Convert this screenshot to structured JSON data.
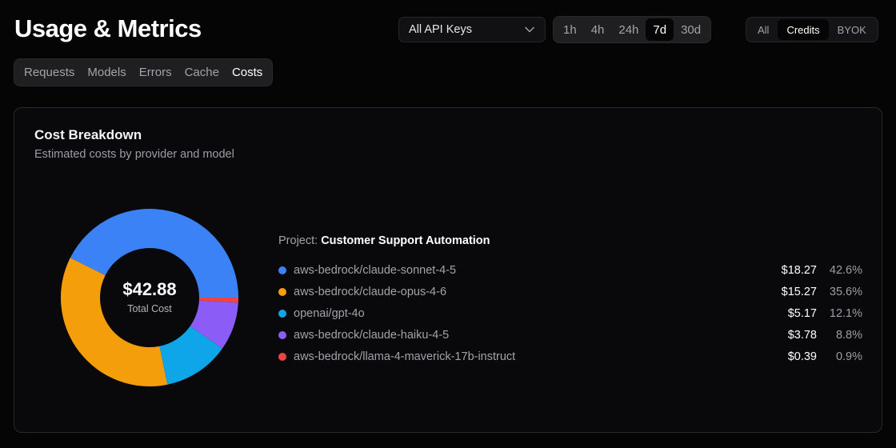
{
  "header": {
    "title": "Usage & Metrics"
  },
  "filters": {
    "api_key_select": {
      "value": "All API Keys",
      "icon": "chevron-down-icon"
    },
    "time_ranges": [
      {
        "label": "1h",
        "active": false
      },
      {
        "label": "4h",
        "active": false
      },
      {
        "label": "24h",
        "active": false
      },
      {
        "label": "7d",
        "active": true
      },
      {
        "label": "30d",
        "active": false
      }
    ],
    "sources": [
      {
        "label": "All",
        "active": false
      },
      {
        "label": "Credits",
        "active": true
      },
      {
        "label": "BYOK",
        "active": false
      }
    ]
  },
  "tabs": [
    {
      "label": "Requests",
      "active": false
    },
    {
      "label": "Models",
      "active": false
    },
    {
      "label": "Errors",
      "active": false
    },
    {
      "label": "Cache",
      "active": false
    },
    {
      "label": "Costs",
      "active": true
    }
  ],
  "card": {
    "title": "Cost Breakdown",
    "subtitle": "Estimated costs by provider and model",
    "total_value": "$42.88",
    "total_label": "Total Cost",
    "project_key": "Project:",
    "project_name": "Customer Support Automation"
  },
  "chart_data": {
    "type": "pie",
    "variant": "donut",
    "title": "Cost Breakdown",
    "total": 42.88,
    "series": [
      {
        "name": "aws-bedrock/claude-sonnet-4-5",
        "value": 18.27,
        "cost_label": "$18.27",
        "percent": 42.6,
        "percent_label": "42.6%",
        "color": "#3b82f6"
      },
      {
        "name": "aws-bedrock/claude-opus-4-6",
        "value": 15.27,
        "cost_label": "$15.27",
        "percent": 35.6,
        "percent_label": "35.6%",
        "color": "#f59e0b"
      },
      {
        "name": "openai/gpt-4o",
        "value": 5.17,
        "cost_label": "$5.17",
        "percent": 12.1,
        "percent_label": "12.1%",
        "color": "#0ea5e9"
      },
      {
        "name": "aws-bedrock/claude-haiku-4-5",
        "value": 3.78,
        "cost_label": "$3.78",
        "percent": 8.8,
        "percent_label": "8.8%",
        "color": "#8b5cf6"
      },
      {
        "name": "aws-bedrock/llama-4-maverick-17b-instruct",
        "value": 0.39,
        "cost_label": "$0.39",
        "percent": 0.9,
        "percent_label": "0.9%",
        "color": "#ef4444"
      }
    ]
  }
}
